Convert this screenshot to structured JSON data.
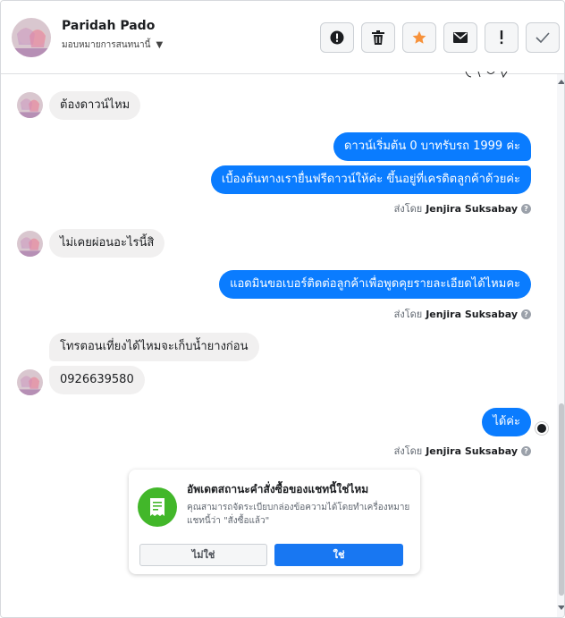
{
  "header": {
    "name": "Paridah Pado",
    "assign_label": "มอบหมายการสนทนานี้"
  },
  "actions": [
    {
      "icon": "alert-circle-icon"
    },
    {
      "icon": "trash-icon"
    },
    {
      "icon": "star-icon",
      "color": "#f7923b"
    },
    {
      "icon": "envelope-icon"
    },
    {
      "icon": "exclamation-icon"
    },
    {
      "icon": "check-icon"
    }
  ],
  "messages": {
    "m1": "ต้องดาวน์ไหม",
    "m2": "ดาวน์เริ่มต้น 0 บาทรับรถ 1999 ค่ะ",
    "m3": "เบื้องต้นทางเรายื่นฟรีดาวน์ให้ค่ะ ขึ้นอยู่ที่เครดิตลูกค้าด้วยค่ะ",
    "m4": "ไม่เคยผ่อนอะไรนี้สิ",
    "m5": "แอดมินขอเบอร์ติดต่อลูกค้าเพื่อพูดคุยรายละเอียดได้ไหมคะ",
    "m6": "โทรตอนเที่ยงได้ไหมจะเก็บน้ำยางก่อน",
    "m7": "0926639580",
    "m8": "ได้ค่ะ"
  },
  "sent_by": {
    "prefix": "ส่งโดย",
    "agent": "Jenjira Suksabay",
    "help": "?"
  },
  "card": {
    "title": "อัพเดตสถานะคำสั่งซื้อของแชทนี้ใช่ไหม",
    "body": "คุณสามารถจัดระเบียบกล่องข้อความได้โดยทำเครื่องหมายแชทนี้ว่า \"สั่งซื้อแล้ว\"",
    "no_label": "ไม่ใช่",
    "yes_label": "ใช่"
  },
  "colors": {
    "outgoing": "#0a7cff",
    "incoming": "#f1f0f0",
    "confirm": "#1877f2",
    "card_icon": "#42b72a"
  }
}
